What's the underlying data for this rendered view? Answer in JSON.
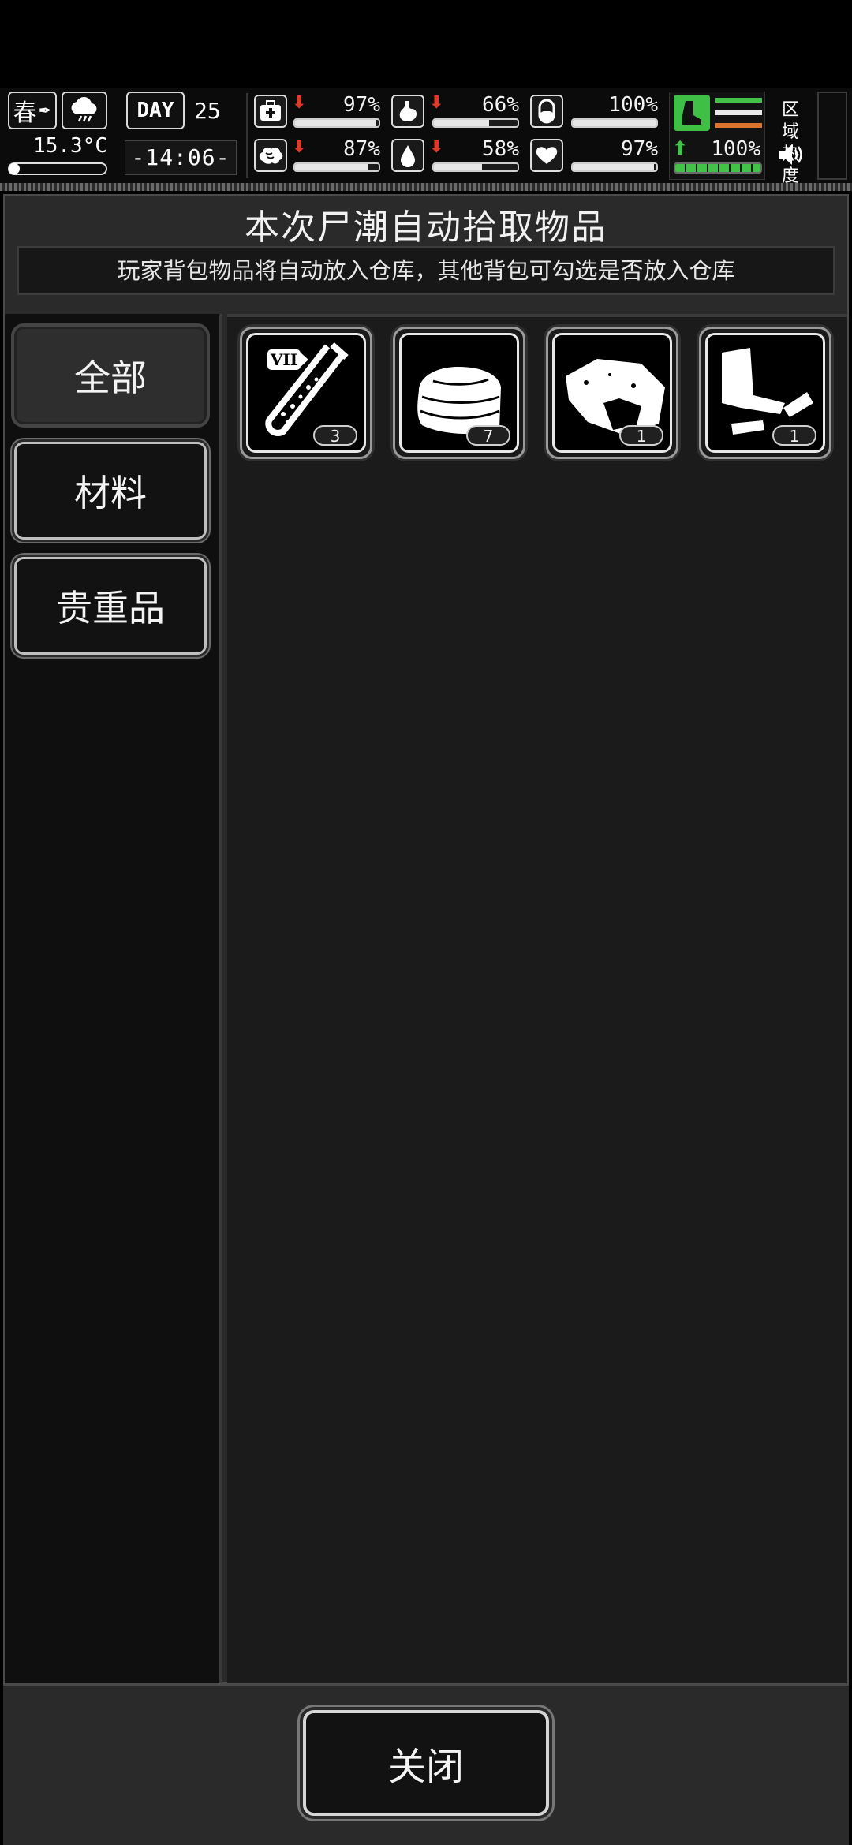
{
  "hud": {
    "season": "春",
    "temperature": "15.3°C",
    "day_label": "DAY",
    "day_number": "25",
    "time": "-14:06-",
    "stats": [
      {
        "name": "health",
        "value": "97%",
        "level": 0.97,
        "trend": "down"
      },
      {
        "name": "hunger",
        "value": "66%",
        "level": 0.66,
        "trend": "down"
      },
      {
        "name": "energy",
        "value": "100%",
        "level": 1.0,
        "trend": "none"
      },
      {
        "name": "sanity",
        "value": "87%",
        "level": 0.87,
        "trend": "down"
      },
      {
        "name": "thirst",
        "value": "58%",
        "level": 0.58,
        "trend": "down"
      },
      {
        "name": "mood",
        "value": "97%",
        "level": 0.97,
        "trend": "none"
      }
    ],
    "stamina": {
      "value": "100%",
      "level": 1.0,
      "trend": "up"
    },
    "region_heat_label": "区域热度",
    "colors": {
      "accent_green": "#43c24a",
      "alert_red": "#e23a2a",
      "heat_orange": "#d9732e"
    }
  },
  "panel": {
    "title": "本次尸潮自动拾取物品",
    "notice": "玩家背包物品将自动放入仓库，其他背包可勾选是否放入仓库"
  },
  "categories": [
    {
      "label": "全部",
      "active": true
    },
    {
      "label": "材料",
      "active": false
    },
    {
      "label": "贵重品",
      "active": false
    }
  ],
  "items": [
    {
      "icon": "test-tube-vii-icon",
      "tag": "VII",
      "count": "3"
    },
    {
      "icon": "cloth-icon",
      "count": "7"
    },
    {
      "icon": "ore-chunk-icon",
      "count": "1"
    },
    {
      "icon": "scrap-metal-icon",
      "count": "1"
    }
  ],
  "footer": {
    "close_label": "关闭"
  }
}
